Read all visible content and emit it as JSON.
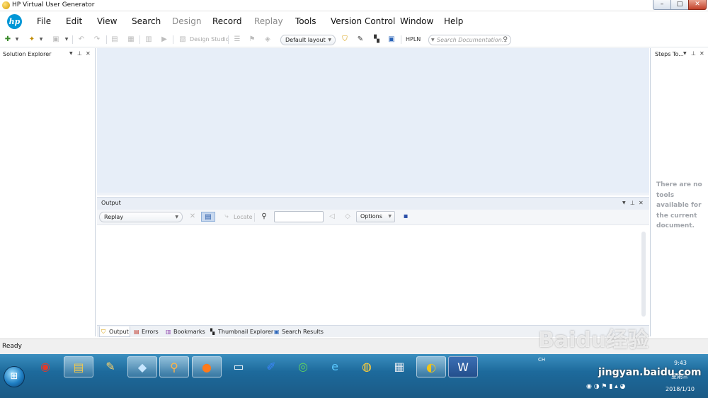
{
  "window": {
    "title": "HP Virtual User Generator",
    "controls": {
      "minimize": "–",
      "maximize": "□",
      "close": "✕"
    }
  },
  "menu": {
    "logo": "hp",
    "items": [
      {
        "label": "File",
        "enabled": true
      },
      {
        "label": "Edit",
        "enabled": true
      },
      {
        "label": "View",
        "enabled": true
      },
      {
        "label": "Search",
        "enabled": true
      },
      {
        "label": "Design",
        "enabled": false
      },
      {
        "label": "Record",
        "enabled": true
      },
      {
        "label": "Replay",
        "enabled": false
      },
      {
        "label": "Tools",
        "enabled": true
      },
      {
        "label": "Version Control",
        "enabled": true
      },
      {
        "label": "Window",
        "enabled": true
      },
      {
        "label": "Help",
        "enabled": true
      }
    ]
  },
  "toolbar": {
    "design_studio": "Design Studio",
    "layout": "Default layout",
    "hpln": "HPLN",
    "search_placeholder": "Search Documentation..."
  },
  "solution_explorer": {
    "title": "Solution Explorer"
  },
  "steps_toolbox": {
    "title": "Steps To...",
    "empty_message": "There are no tools available for the current document."
  },
  "output": {
    "title": "Output",
    "filter": "Replay",
    "locate": "Locate",
    "options": "Options",
    "tabs": [
      {
        "label": "Output",
        "icon": "output-icon"
      },
      {
        "label": "Errors",
        "icon": "errors-icon"
      },
      {
        "label": "Bookmarks",
        "icon": "bookmarks-icon"
      },
      {
        "label": "Thumbnail Explorer",
        "icon": "thumbnail-icon"
      },
      {
        "label": "Search Results",
        "icon": "search-results-icon"
      }
    ]
  },
  "status": {
    "text": "Ready"
  },
  "taskbar": {
    "clock_time": "9:43",
    "clock_weekday": "星期三",
    "clock_date": "2018/1/10",
    "lang": "CH"
  },
  "watermark": {
    "brand": "Baidu经验",
    "url": "jingyan.baidu.com"
  }
}
